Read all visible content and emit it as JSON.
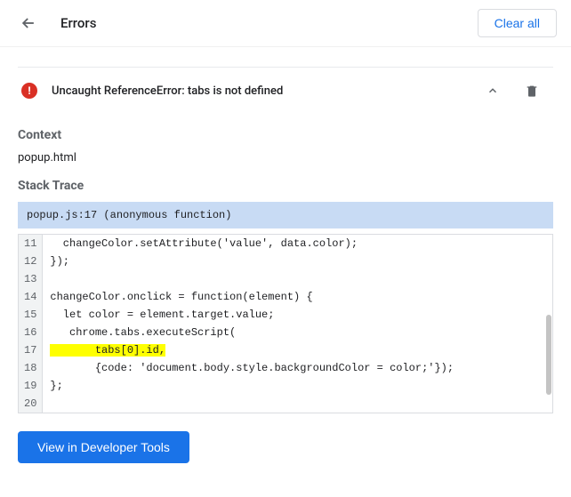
{
  "header": {
    "title": "Errors",
    "clear_all": "Clear all"
  },
  "error": {
    "badge_symbol": "!",
    "title": "Uncaught ReferenceError: tabs is not defined",
    "context_label": "Context",
    "context_value": "popup.html",
    "stack_trace_label": "Stack Trace",
    "trace_banner": "popup.js:17 (anonymous function)"
  },
  "code": {
    "lines": [
      {
        "n": "11",
        "text": "  changeColor.setAttribute('value', data.color);",
        "hl": false
      },
      {
        "n": "12",
        "text": "});",
        "hl": false
      },
      {
        "n": "13",
        "text": "",
        "hl": false
      },
      {
        "n": "14",
        "text": "changeColor.onclick = function(element) {",
        "hl": false
      },
      {
        "n": "15",
        "text": "  let color = element.target.value;",
        "hl": false
      },
      {
        "n": "16",
        "text": "   chrome.tabs.executeScript(",
        "hl": false
      },
      {
        "n": "17",
        "text": "       tabs[0].id,",
        "hl": true
      },
      {
        "n": "18",
        "text": "       {code: 'document.body.style.backgroundColor = color;'});",
        "hl": false
      },
      {
        "n": "19",
        "text": "};",
        "hl": false
      },
      {
        "n": "20",
        "text": "",
        "hl": false
      }
    ]
  },
  "footer": {
    "dev_tools_label": "View in Developer Tools"
  }
}
